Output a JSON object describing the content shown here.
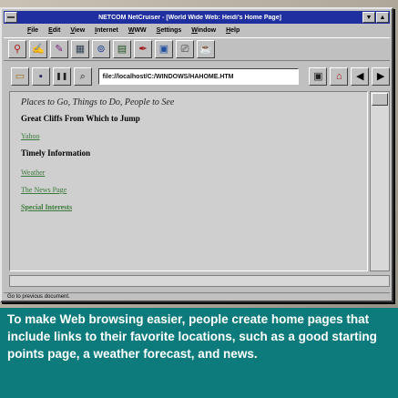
{
  "window": {
    "title": "NETCOM NetCruiser - [World Wide Web: Heidi's Home Page]",
    "minimize_glyph": "▼",
    "maximize_glyph": "▲",
    "restore_glyph": "◆"
  },
  "menu": [
    "File",
    "Edit",
    "View",
    "Internet",
    "WWW",
    "Settings",
    "Window",
    "Help"
  ],
  "toolbar1_icons": [
    "pin-icon",
    "wand-icon",
    "pencil-icon",
    "grid-icon",
    "dial-icon",
    "sheet-icon",
    "pen-icon",
    "picture-icon",
    "monitor-icon",
    "teapot-icon"
  ],
  "toolbar1_glyphs": [
    "⚲",
    "✍",
    "✎",
    "▦",
    "⊚",
    "▤",
    "✒",
    "▣",
    "⎚",
    "☕"
  ],
  "toolbar2": {
    "icons": [
      "open-folder-icon",
      "save-icon",
      "pause-icon",
      "find-icon"
    ],
    "glyphs": [
      "▭",
      "▪",
      "❚❚",
      "⌕"
    ],
    "url": "file://localhost/C:/WINDOWS/HAHOME.HTM",
    "right_icons": [
      "stop-icon",
      "home-icon",
      "back-icon",
      "forward-icon"
    ],
    "right_glyphs": [
      "▣",
      "⌂",
      "◀",
      "▶"
    ]
  },
  "content": {
    "heading": "Places to Go, Things to Do, People to See",
    "section1": "Great Cliffs From Which to Jump",
    "link1": "Yahoo",
    "section2": "Timely Information",
    "link2": "Weather",
    "link3": "The News Page",
    "link4": "Special Interests"
  },
  "status": "Go to previous document.",
  "caption": "To make Web browsing easier, people create home pages that include links to their favorite locations, such as a good starting points page, a weather forecast, and news.",
  "colors": {
    "titlebar": "#1f2fa0",
    "caption_bg": "#0d7b7c",
    "link": "#3a7a3a"
  }
}
